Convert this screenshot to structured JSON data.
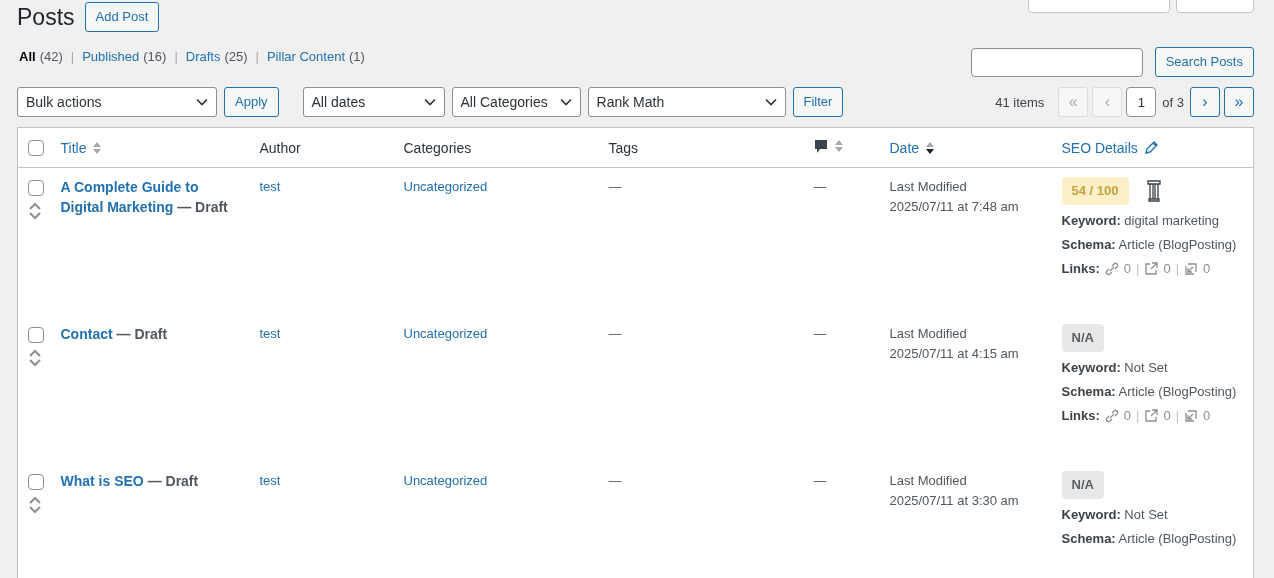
{
  "header": {
    "title": "Posts",
    "add_button": "Add Post"
  },
  "top_tabs": [
    {
      "kind": "tab"
    },
    {
      "kind": "tab"
    }
  ],
  "views": [
    {
      "label": "All",
      "count": "(42)",
      "selected": true
    },
    {
      "separator": "|",
      "label": "Published",
      "count": "(16)",
      "selected": false
    },
    {
      "separator": "|",
      "label": "Drafts",
      "count": "(25)",
      "selected": false
    },
    {
      "separator": "|",
      "label": "Pillar Content",
      "count": "(1)",
      "selected": false
    }
  ],
  "search": {
    "button": "Search Posts"
  },
  "bulk": {
    "select": "Bulk actions",
    "apply": "Apply"
  },
  "filters": {
    "selects": [
      "All dates",
      "All Categories",
      "Rank Math"
    ],
    "button": "Filter"
  },
  "pagination": {
    "items": "41 items",
    "buttons": [
      {
        "label": "«",
        "disabled": true
      },
      {
        "label": "‹",
        "disabled": true
      }
    ],
    "page": "1",
    "of": "of 3",
    "next_buttons": [
      {
        "label": "›",
        "disabled": false
      },
      {
        "label": "»",
        "disabled": false
      }
    ]
  },
  "table": {
    "select_all_checked": false,
    "columns": [
      {
        "kind": "text",
        "label": "Title",
        "link": true,
        "sortable": true,
        "sorted_desc": false
      },
      {
        "kind": "text",
        "label": "Author",
        "link": false
      },
      {
        "kind": "text",
        "label": "Categories",
        "link": false
      },
      {
        "kind": "text",
        "label": "Tags",
        "link": false
      },
      {
        "kind": "comments",
        "sortable": true,
        "sorted_desc": false
      },
      {
        "kind": "text",
        "label": "Date",
        "link": true,
        "sortable": true,
        "sorted_desc": true
      },
      {
        "kind": "seo",
        "label": "SEO Details",
        "link": true
      }
    ],
    "rows": [
      {
        "checked": false,
        "title": "A Complete Guide to Digital Marketing",
        "state": "— Draft",
        "author": "test",
        "categories": "Uncategorized",
        "tags": "—",
        "comments": "—",
        "date_label": "Last Modified",
        "date": "2025/07/11 at 7:48 am",
        "seo": {
          "kind": "score",
          "score": "54 / 100",
          "pillar": true,
          "keyword_label": "Keyword:",
          "keyword": "digital marketing",
          "schema_label": "Schema:",
          "schema": "Article (BlogPosting)",
          "links_label": "Links:",
          "links": [
            {
              "count": "0"
            },
            {
              "separator": "|",
              "count": "0"
            },
            {
              "separator": "|",
              "count": "0"
            }
          ]
        }
      },
      {
        "checked": false,
        "title": "Contact",
        "state": "— Draft",
        "author": "test",
        "categories": "Uncategorized",
        "tags": "—",
        "comments": "—",
        "date_label": "Last Modified",
        "date": "2025/07/11 at 4:15 am",
        "seo": {
          "kind": "na",
          "score": "N/A",
          "pillar": false,
          "keyword_label": "Keyword:",
          "keyword": "Not Set",
          "schema_label": "Schema:",
          "schema": "Article (BlogPosting)",
          "links_label": "Links:",
          "links": [
            {
              "count": "0"
            },
            {
              "separator": "|",
              "count": "0"
            },
            {
              "separator": "|",
              "count": "0"
            }
          ]
        }
      },
      {
        "checked": false,
        "title": "What is SEO",
        "state": "— Draft",
        "author": "test",
        "categories": "Uncategorized",
        "tags": "—",
        "comments": "—",
        "date_label": "Last Modified",
        "date": "2025/07/11 at 3:30 am",
        "seo": {
          "kind": "na",
          "score": "N/A",
          "pillar": false,
          "keyword_label": "Keyword:",
          "keyword": "Not Set",
          "schema_label": "Schema:",
          "schema": "Article (BlogPosting)"
        }
      }
    ]
  }
}
